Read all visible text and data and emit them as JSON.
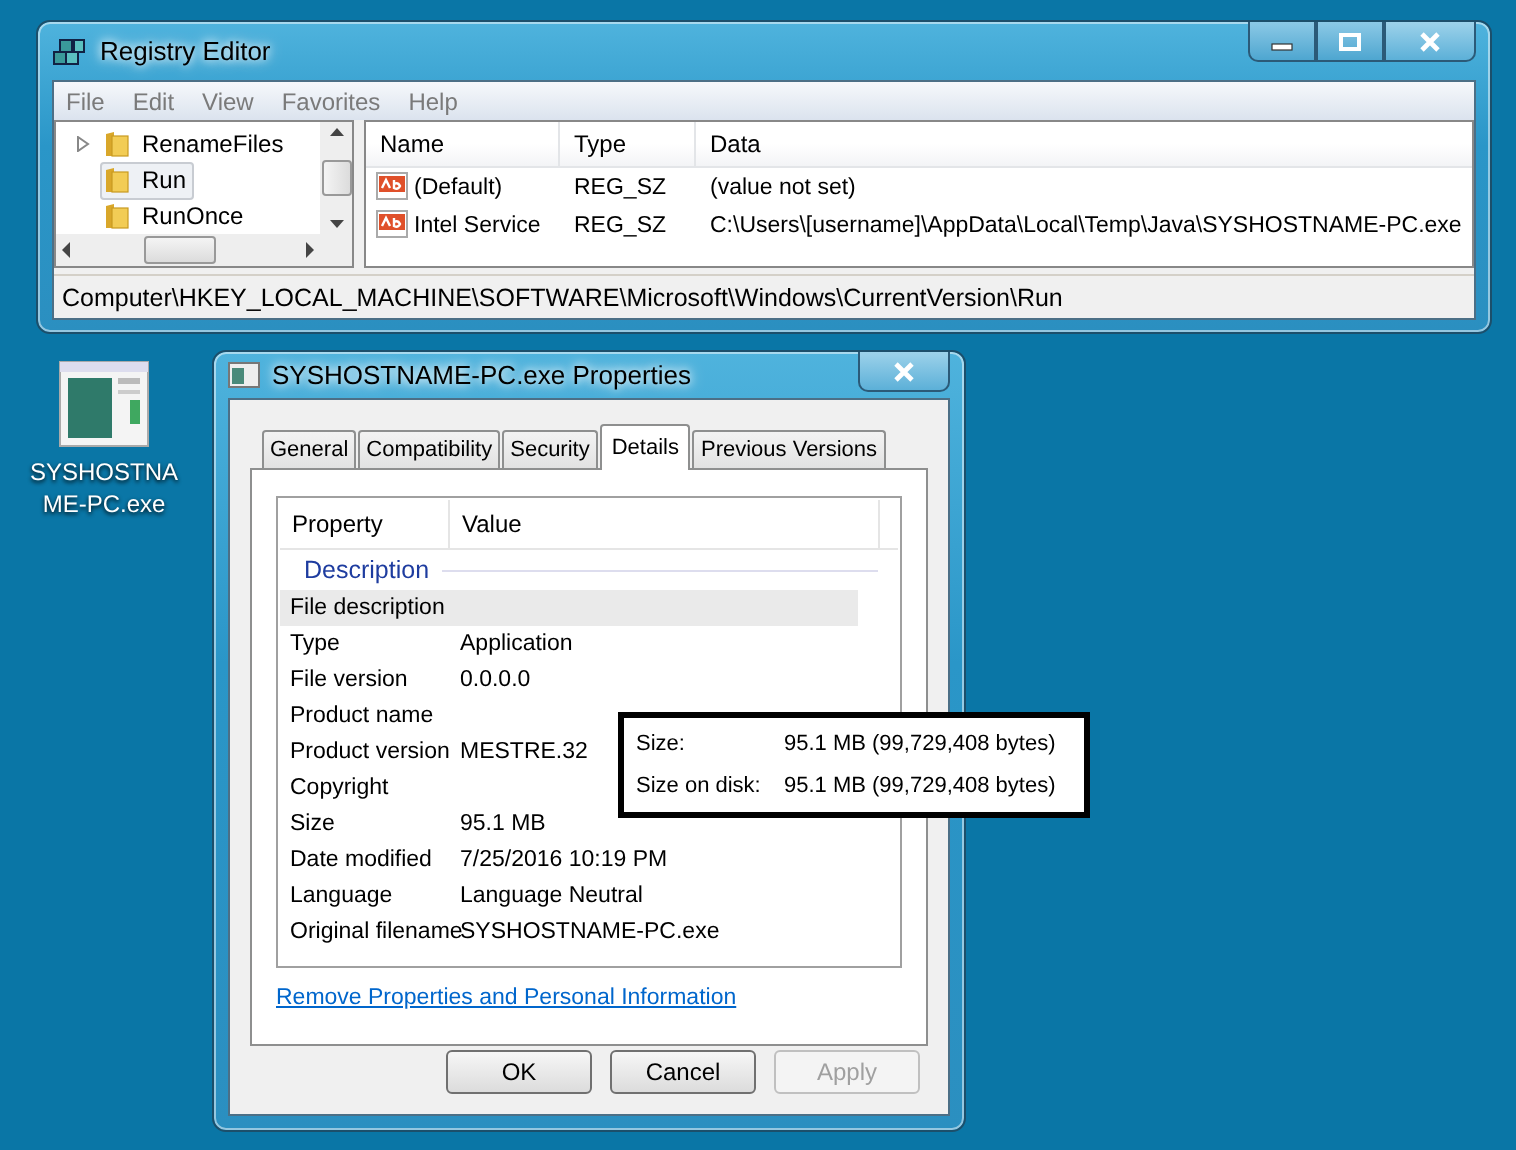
{
  "registry_window": {
    "title": "Registry Editor",
    "menu": [
      "File",
      "Edit",
      "View",
      "Favorites",
      "Help"
    ],
    "tree": [
      {
        "label": "RenameFiles",
        "expandable": true,
        "selected": false
      },
      {
        "label": "Run",
        "expandable": false,
        "selected": true
      },
      {
        "label": "RunOnce",
        "expandable": false,
        "selected": false
      }
    ],
    "columns": [
      "Name",
      "Type",
      "Data"
    ],
    "values": [
      {
        "name": "(Default)",
        "type": "REG_SZ",
        "data": "(value not set)"
      },
      {
        "name": "Intel Service",
        "type": "REG_SZ",
        "data": "C:\\Users\\[username]\\AppData\\Local\\Temp\\Java\\SYSHOSTNAME-PC.exe"
      }
    ],
    "status_bar": "Computer\\HKEY_LOCAL_MACHINE\\SOFTWARE\\Microsoft\\Windows\\CurrentVersion\\Run"
  },
  "desktop_icon": {
    "label_lines": [
      "SYSHOSTNA",
      "ME-PC.exe"
    ]
  },
  "properties_window": {
    "title": "SYSHOSTNAME-PC.exe Properties",
    "tabs": [
      {
        "label": "General",
        "selected": false
      },
      {
        "label": "Compatibility",
        "selected": false
      },
      {
        "label": "Security",
        "selected": false
      },
      {
        "label": "Details",
        "selected": true
      },
      {
        "label": "Previous Versions",
        "selected": false
      }
    ],
    "columns": [
      "Property",
      "Value"
    ],
    "group": "Description",
    "rows": [
      {
        "property": "File description",
        "selected": true
      },
      {
        "property": "Type",
        "value": "Application",
        "selected": false
      },
      {
        "property": "File version",
        "value": "0.0.0.0",
        "selected": false
      },
      {
        "property": "Product name",
        "selected": false
      },
      {
        "property": "Product version",
        "value": "MESTRE.32",
        "selected": false
      },
      {
        "property": "Copyright",
        "selected": false
      },
      {
        "property": "Size",
        "value": "95.1 MB",
        "selected": false
      },
      {
        "property": "Date modified",
        "value": "7/25/2016 10:19 PM",
        "selected": false
      },
      {
        "property": "Language",
        "value": "Language Neutral",
        "selected": false
      },
      {
        "property": "Original filename",
        "value": "SYSHOSTNAME-PC.exe",
        "selected": false
      }
    ],
    "link": "Remove Properties and Personal Information",
    "buttons": [
      {
        "label": "OK",
        "disabled": false
      },
      {
        "label": "Cancel",
        "disabled": false
      },
      {
        "label": "Apply",
        "disabled": true
      }
    ]
  },
  "size_callout": {
    "rows": [
      {
        "label": "Size:",
        "value": "95.1 MB (99,729,408 bytes)"
      },
      {
        "label": "Size on disk:",
        "value": "95.1 MB (99,729,408 bytes)"
      }
    ]
  }
}
